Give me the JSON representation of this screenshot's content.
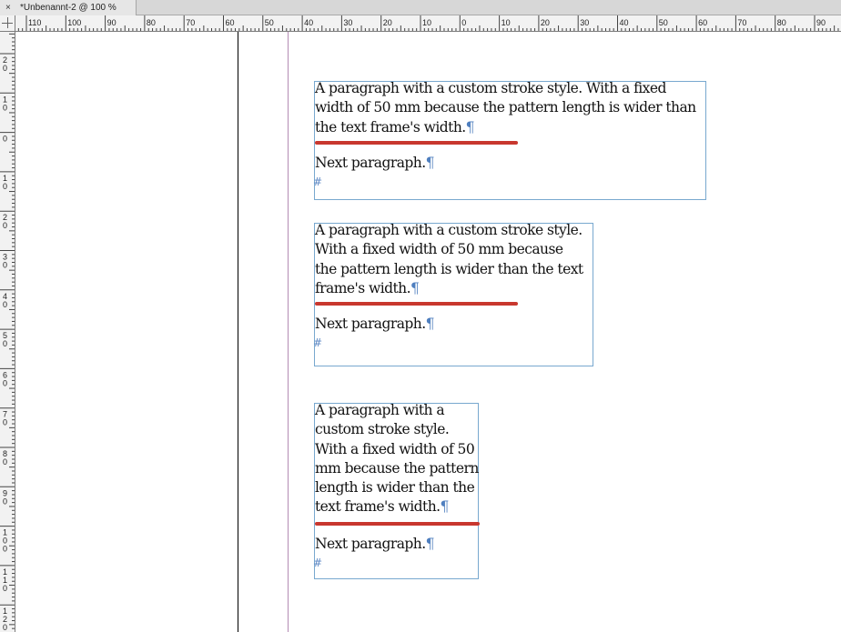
{
  "document": {
    "tab_title": "*Unbenannt-2 @ 100 %",
    "close_glyph": "×"
  },
  "rulers": {
    "horizontal_labels": [
      "110",
      "100",
      "90",
      "80",
      "70",
      "60",
      "50",
      "40",
      "30",
      "20",
      "10",
      "0",
      "10",
      "20",
      "30",
      "40",
      "50",
      "60",
      "70",
      "80",
      "90"
    ],
    "vertical_labels": [
      "2 0",
      "1 0",
      "0",
      "1 0",
      "2 0",
      "3 0",
      "4 0",
      "5 0",
      "6 0",
      "7 0",
      "8 0",
      "9 0",
      "1 0 0",
      "1 1 0",
      "1 2 0"
    ]
  },
  "frames": [
    {
      "name": "frame-wide",
      "lines": [
        "A paragraph with a custom stroke style. With a fixed",
        "width of 50 mm because the pattern length is wider than",
        "the text frame's width."
      ],
      "next_paragraph": "Next paragraph.",
      "pilcrow": "¶",
      "end_marker": "#",
      "stroke_color": "#c8372e"
    },
    {
      "name": "frame-medium",
      "lines": [
        "A paragraph with a custom stroke style.",
        "With a fixed width of 50 mm because",
        "the pattern length is wider than the text",
        "frame's width."
      ],
      "next_paragraph": "Next paragraph.",
      "pilcrow": "¶",
      "end_marker": "#",
      "stroke_color": "#c8372e"
    },
    {
      "name": "frame-narrow",
      "lines": [
        "A paragraph with a",
        "custom stroke style.",
        "With a fixed width of 50",
        "mm because the pattern",
        "length is wider than the",
        "text frame's width."
      ],
      "next_paragraph": "Next paragraph.",
      "pilcrow": "¶",
      "end_marker": "#",
      "stroke_color": "#c8372e"
    }
  ],
  "colors": {
    "frame_border": "#78a8cf",
    "guide_margin": "#b48bb4",
    "hidden_chars": "#4f7fbf"
  }
}
